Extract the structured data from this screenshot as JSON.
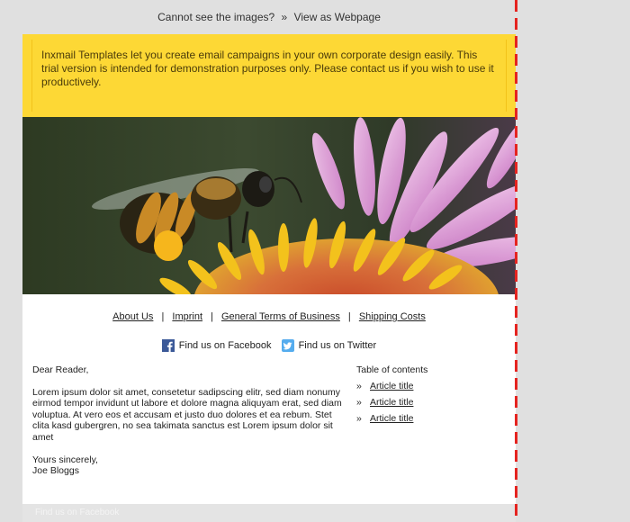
{
  "top_bar": {
    "cannot_see": "Cannot see the images?",
    "separator": "»",
    "view_as_webpage": "View as Webpage"
  },
  "notice": {
    "text": "Inxmail Templates let you create email campaigns in your own corporate design easily. This trial version is intended for demonstration purposes only. Please contact us if you wish to use it productively."
  },
  "hero": {
    "icon": "bee-on-flower-image"
  },
  "nav": {
    "items": [
      "About Us",
      "Imprint",
      "General Terms of Business",
      "Shipping Costs"
    ],
    "separator": "|"
  },
  "social": {
    "facebook": "Find us on Facebook",
    "twitter": "Find us on Twitter",
    "facebook_icon": "facebook-icon",
    "twitter_icon": "twitter-icon"
  },
  "body": {
    "greeting": "Dear Reader,",
    "paragraph": "Lorem ipsum dolor sit amet, consetetur sadipscing elitr, sed diam nonumy eirmod tempor invidunt ut labore et dolore magna aliquyam erat, sed diam voluptua. At vero eos et accusam et justo duo dolores et ea rebum. Stet clita kasd gubergren, no sea takimata sanctus est Lorem ipsum dolor sit amet",
    "closing": "Yours sincerely,",
    "signature": "Joe Bloggs"
  },
  "toc": {
    "title": "Table of contents",
    "bullet": "»",
    "items": [
      "Article title",
      "Article title",
      "Article title"
    ]
  },
  "footer": {
    "text": "Find us on Facebook"
  },
  "colors": {
    "notice_bg": "#fdd835",
    "page_bg": "#e0e0e0",
    "dashed_line": "#e52420",
    "facebook": "#3b5998",
    "twitter": "#55acee"
  }
}
